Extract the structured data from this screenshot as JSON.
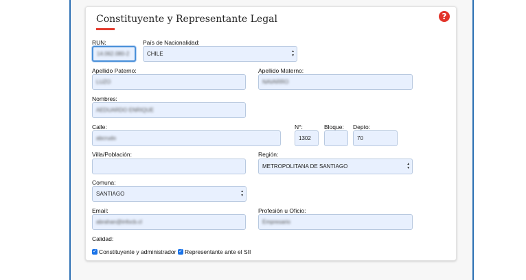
{
  "section": {
    "title": "Constituyente y Representante Legal",
    "help_icon": "?"
  },
  "fields": {
    "run": {
      "label": "RUN:",
      "value": "14.062.080-2"
    },
    "nacionalidad": {
      "label": "País de Nacionalidad:",
      "value": "CHILE"
    },
    "apellido_paterno": {
      "label": "Apellido Paterno:",
      "value": "LUZO"
    },
    "apellido_materno": {
      "label": "Apellido Materno:",
      "value": "NAVARRO"
    },
    "nombres": {
      "label": "Nombres:",
      "value": "AEDUARDO ENRIQUE"
    },
    "calle": {
      "label": "Calle:",
      "value": "abcrudo"
    },
    "numero": {
      "label": "N°:",
      "value": "1302"
    },
    "bloque": {
      "label": "Bloque:",
      "value": ""
    },
    "depto": {
      "label": "Depto:",
      "value": "70"
    },
    "villa": {
      "label": "Villa/Población:",
      "value": ""
    },
    "region": {
      "label": "Región:",
      "value": "METROPOLITANA DE SANTIAGO"
    },
    "comuna": {
      "label": "Comuna:",
      "value": "SANTIAGO"
    },
    "email": {
      "label": "Email:",
      "value": "abrahan@infocb.cl"
    },
    "profesion": {
      "label": "Profesión u Oficio:",
      "value": "Empresario"
    }
  },
  "calidad": {
    "label": "Calidad:",
    "options": [
      {
        "label": "Constituyente y administrador",
        "checked": true
      },
      {
        "label": "Representante ante el SII",
        "checked": true
      }
    ]
  }
}
